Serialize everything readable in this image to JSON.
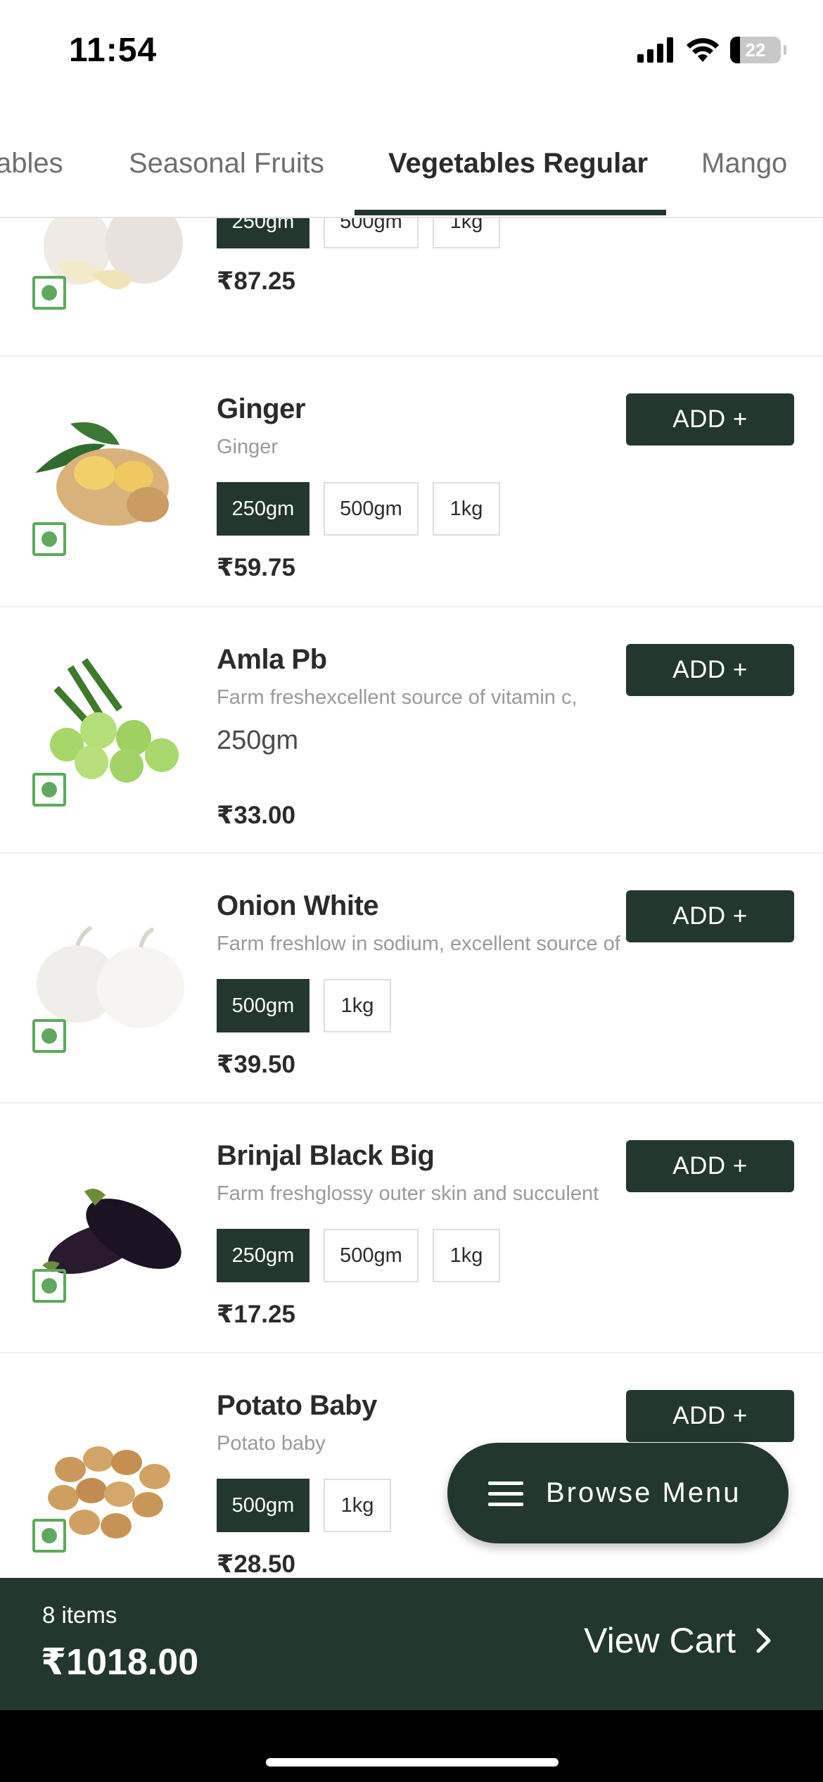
{
  "status_bar": {
    "time": "11:54",
    "battery": "22"
  },
  "tabs": [
    {
      "label": "ables",
      "active": false
    },
    {
      "label": "Seasonal Fruits",
      "active": false
    },
    {
      "label": "Vegetables Regular",
      "active": true
    },
    {
      "label": "Mango",
      "active": false
    }
  ],
  "products": [
    {
      "name": "",
      "description": "",
      "variants": [
        "250gm",
        "500gm",
        "1kg"
      ],
      "selected": "250gm",
      "price": "₹87.25",
      "image": "garlic"
    },
    {
      "name": "Ginger",
      "description": "Ginger",
      "variants": [
        "250gm",
        "500gm",
        "1kg"
      ],
      "selected": "250gm",
      "price": "₹59.75",
      "add_label": "ADD +",
      "image": "ginger"
    },
    {
      "name": "Amla Pb",
      "description": "Farm freshexcellent source of vitamin c,",
      "weight": "250gm",
      "price": "₹33.00",
      "add_label": "ADD +",
      "image": "amla"
    },
    {
      "name": "Onion White",
      "description": "Farm freshlow in sodium, excellent source of",
      "variants": [
        "500gm",
        "1kg"
      ],
      "selected": "500gm",
      "price": "₹39.50",
      "add_label": "ADD +",
      "image": "onion"
    },
    {
      "name": "Brinjal Black Big",
      "description": "Farm freshglossy outer skin and succulent",
      "variants": [
        "250gm",
        "500gm",
        "1kg"
      ],
      "selected": "250gm",
      "price": "₹17.25",
      "add_label": "ADD +",
      "image": "brinjal"
    },
    {
      "name": "Potato Baby",
      "description": "Potato baby",
      "variants": [
        "500gm",
        "1kg"
      ],
      "selected": "500gm",
      "price": "₹28.50",
      "add_label": "ADD +",
      "image": "potato"
    }
  ],
  "browse_menu": {
    "label": "Browse Menu"
  },
  "cart": {
    "items": "8 items",
    "total": "₹1018.00",
    "view_label": "View Cart"
  },
  "colors": {
    "brand": "#22372d",
    "veg_mark": "#5ea95b"
  }
}
